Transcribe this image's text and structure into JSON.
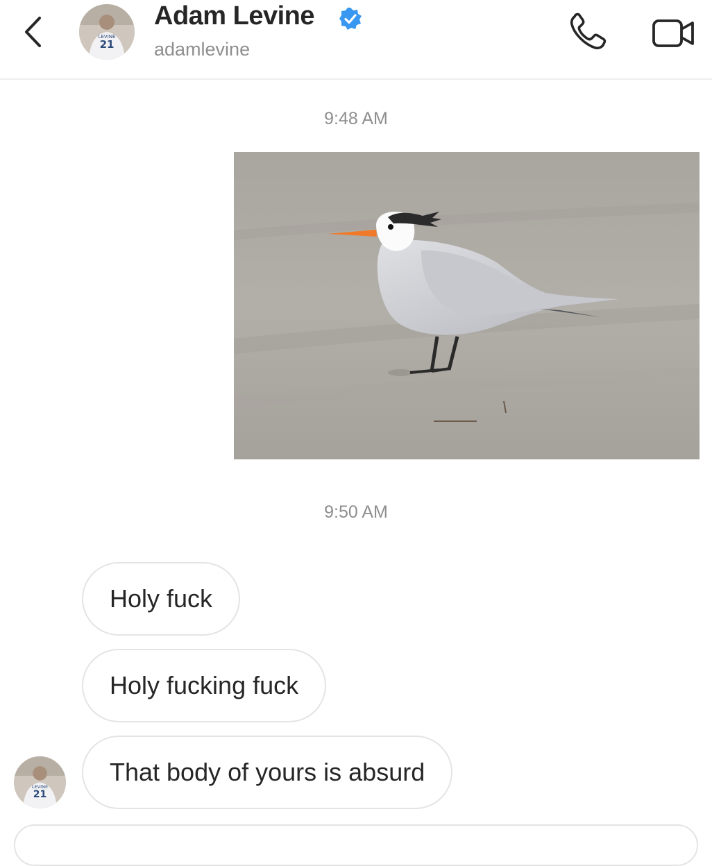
{
  "header": {
    "contact_name": "Adam Levine",
    "contact_handle": "adamlevine",
    "verified": true,
    "icons": {
      "back": "chevron-left-icon",
      "call": "phone-icon",
      "video": "video-camera-icon",
      "verified": "verified-badge-icon"
    }
  },
  "thread": {
    "timestamp_1": "9:48 AM",
    "sent_photo": {
      "kind": "photo",
      "subject": "tern-bird"
    },
    "timestamp_2": "9:50 AM",
    "messages": [
      {
        "text": "Holy fuck"
      },
      {
        "text": "Holy fucking fuck"
      },
      {
        "text": "That body of yours is absurd"
      }
    ]
  },
  "colors": {
    "text": "#262626",
    "secondary_text": "#8e8e8e",
    "verified_blue": "#3897f0",
    "bubble_border": "#e4e4e4",
    "background": "#ffffff"
  }
}
